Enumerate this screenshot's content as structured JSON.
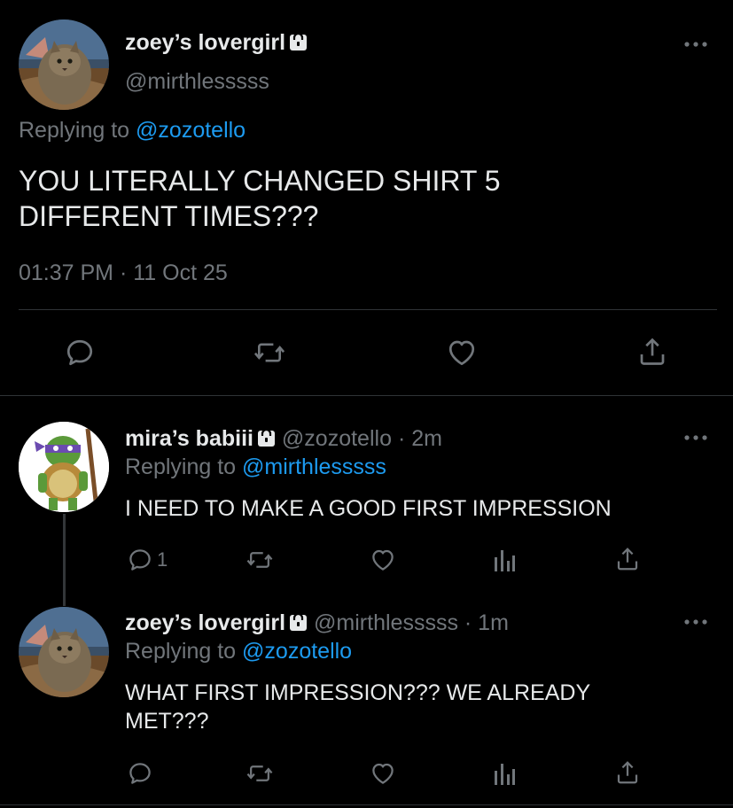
{
  "main_tweet": {
    "display_name": "zoey’s lovergirl",
    "handle": "@mirthlesssss",
    "replying_prefix": "Replying to",
    "replying_to": "@zozotello",
    "text_lines": [
      "YOU LITERALLY CHANGED SHIRT 5",
      "DIFFERENT TIMES???"
    ],
    "time": "01:37 PM",
    "separator": "·",
    "date": "11 Oct 25",
    "more_icon": "more-horizontal-icon",
    "actions": [
      "reply-icon",
      "retweet-icon",
      "like-icon",
      "share-icon"
    ]
  },
  "replies": [
    {
      "display_name": "mira’s babiii",
      "handle": "@zozotello",
      "age": "2m",
      "separator": "·",
      "replying_prefix": "Replying to",
      "replying_to": "@mirthlesssss",
      "text_lines": [
        "I NEED TO MAKE A GOOD FIRST IMPRESSION"
      ],
      "reply_count": "1",
      "avatar": "ninja-turtle-avatar"
    },
    {
      "display_name": "zoey’s lovergirl",
      "handle": "@mirthlesssss",
      "age": "1m",
      "separator": "·",
      "replying_prefix": "Replying to",
      "replying_to": "@zozotello",
      "text_lines": [
        "WHAT FIRST IMPRESSION??? WE ALREADY",
        "MET???"
      ],
      "reply_count": "",
      "avatar": "cat-avatar"
    }
  ],
  "colors": {
    "background": "#000000",
    "text": "#e7e9ea",
    "muted": "#71767b",
    "link": "#1d9bf0",
    "divider": "#2f3336"
  }
}
